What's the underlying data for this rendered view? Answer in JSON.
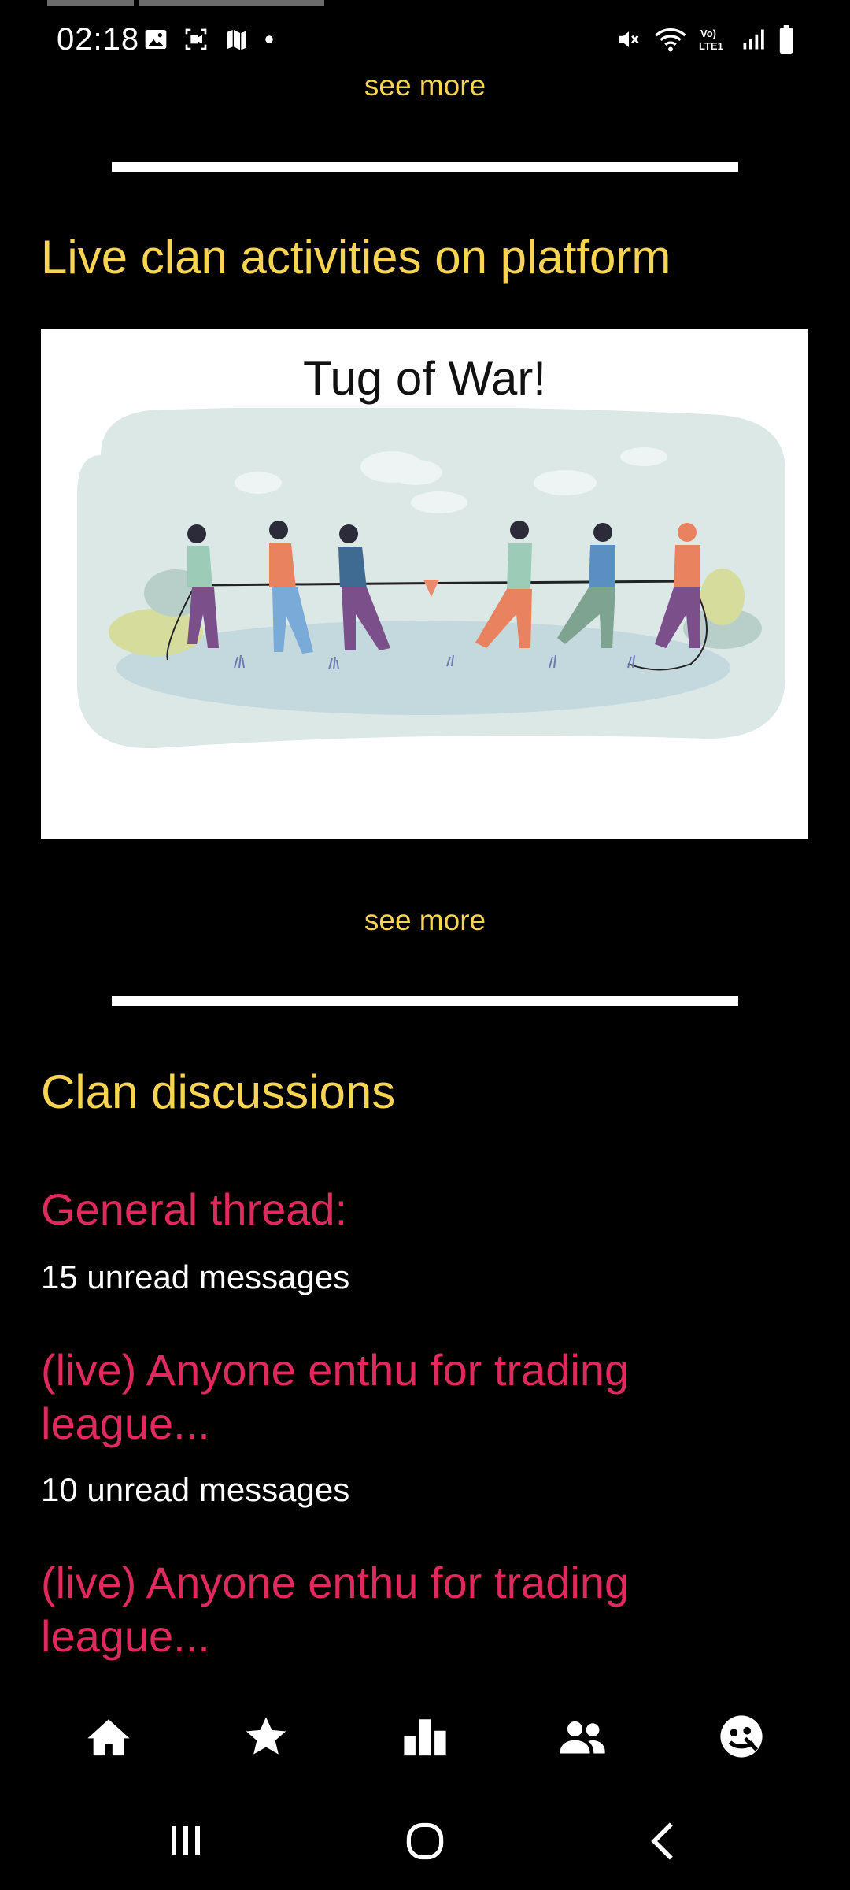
{
  "status_bar": {
    "time": "02:18",
    "left_icons": [
      "gallery-icon",
      "screen-record-icon",
      "map-icon",
      "dot-icon"
    ],
    "right_icons": [
      "mute-icon",
      "wifi-icon",
      "volte-icon",
      "signal-icon",
      "battery-icon"
    ],
    "volte_label": "Vo)\nLTE1"
  },
  "top_see_more": "see more",
  "activities": {
    "title": "Live clan activities on platform",
    "card": {
      "title": "Tug of War!",
      "image": "tug-of-war-illustration"
    },
    "see_more": "see more"
  },
  "discussions": {
    "title": "Clan discussions",
    "threads": [
      {
        "title": "General thread:",
        "unread": "15 unread messages"
      },
      {
        "title": "(live) Anyone enthu for trading league...",
        "unread": "10 unread messages"
      },
      {
        "title": "(live) Anyone enthu for trading league..."
      }
    ]
  },
  "bottom_nav": [
    "home-icon",
    "star-icon",
    "leaderboard-icon",
    "people-icon",
    "profile-icon"
  ],
  "system_nav": [
    "recents-icon",
    "home-circle-icon",
    "back-icon"
  ],
  "colors": {
    "accent_yellow": "#f7d451",
    "thread_red": "#e02a5d",
    "background": "#000000"
  }
}
